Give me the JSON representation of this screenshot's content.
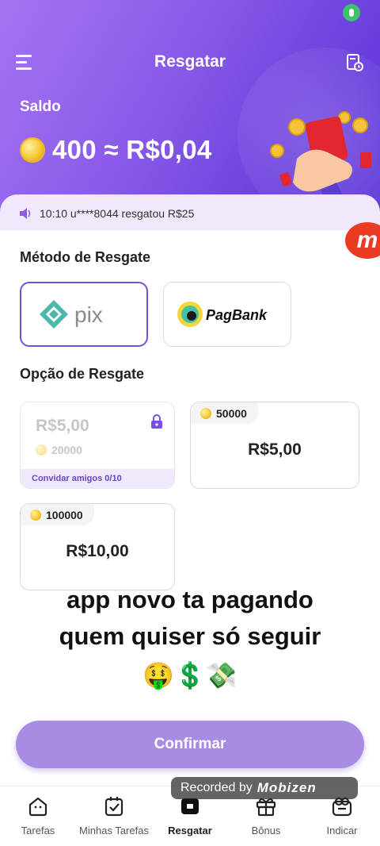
{
  "status": {
    "mic_color": "#3cc46b"
  },
  "header": {
    "title": "Resgatar",
    "menu_icon": "menu-icon",
    "history_icon": "history-icon",
    "balance_label": "Saldo",
    "balance_value": "400 ≈ R$0,04"
  },
  "ticker": {
    "text": "10:10 u****8044 resgatou R$25"
  },
  "floating_logo": "m",
  "method": {
    "title": "Método de Resgate",
    "options": [
      {
        "name": "pix",
        "label": "pix",
        "selected": true
      },
      {
        "name": "pagbank",
        "label": "PagBank",
        "selected": false
      }
    ]
  },
  "redeem": {
    "title": "Opção de Resgate",
    "options": [
      {
        "amount": "R$5,00",
        "coins": "20000",
        "locked": true,
        "note": "Convidar amigos 0/10"
      },
      {
        "amount": "R$5,00",
        "coins": "50000",
        "locked": false
      },
      {
        "amount": "R$10,00",
        "coins": "100000",
        "locked": false
      }
    ]
  },
  "overlay": {
    "line1": "app novo ta pagando",
    "line2": "quem quiser só seguir",
    "emojis": "🤑💲💸"
  },
  "confirm_label": "Confirmar",
  "recorder": {
    "prefix": "Recorded by",
    "brand": "Mobizen"
  },
  "tabs": [
    {
      "label": "Tarefas",
      "icon": "home-icon"
    },
    {
      "label": "Minhas Tarefas",
      "icon": "checklist-icon"
    },
    {
      "label": "Resgatar",
      "icon": "redeem-icon",
      "active": true
    },
    {
      "label": "Bônus",
      "icon": "gift-icon"
    },
    {
      "label": "Indicar",
      "icon": "invite-icon"
    }
  ],
  "colors": {
    "accent": "#7a4fd8",
    "confirm": "#a88be2",
    "header_start": "#a574f2",
    "header_end": "#5a34d6"
  }
}
